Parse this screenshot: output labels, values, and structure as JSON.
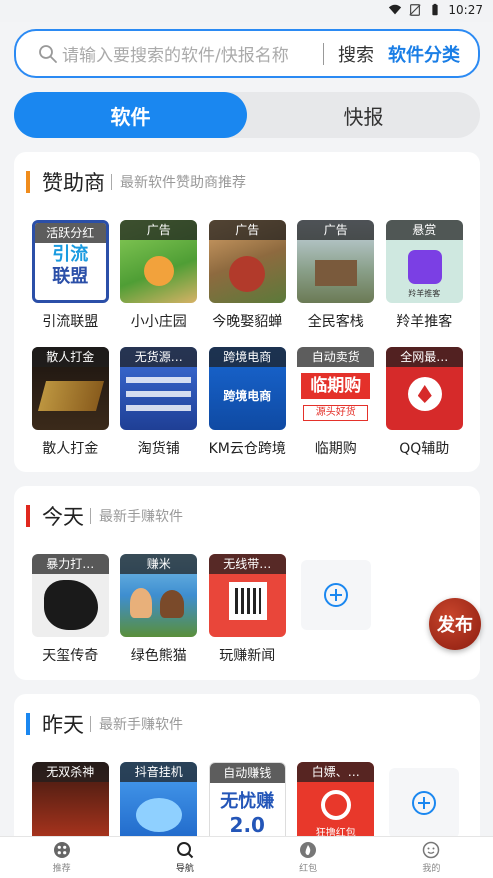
{
  "status": {
    "time": "10:27"
  },
  "search": {
    "placeholder": "请输入要搜索的软件/快报名称",
    "search_label": "搜索",
    "category_label": "软件分类"
  },
  "tabs": [
    {
      "label": "软件"
    },
    {
      "label": "快报"
    }
  ],
  "sponsors": {
    "title": "赞助商",
    "subtitle": "最新软件赞助商推荐",
    "items": [
      {
        "tag": "活跃分红",
        "name": "引流联盟"
      },
      {
        "tag": "广告",
        "name": "小小庄园"
      },
      {
        "tag": "广告",
        "name": "今晚娶貂蝉"
      },
      {
        "tag": "广告",
        "name": "全民客栈"
      },
      {
        "tag": "悬赏",
        "name": "羚羊推客"
      },
      {
        "tag": "散人打金",
        "name": "散人打金"
      },
      {
        "tag": "无货源…",
        "name": "淘货铺"
      },
      {
        "tag": "跨境电商",
        "name": "KM云仓跨境"
      },
      {
        "tag": "自动卖货",
        "name": "临期购"
      },
      {
        "tag": "全网最…",
        "name": "QQ辅助"
      }
    ]
  },
  "today": {
    "title": "今天",
    "subtitle": "最新手赚软件",
    "items": [
      {
        "tag": "暴力打…",
        "name": "天玺传奇"
      },
      {
        "tag": "赚米",
        "name": "绿色熊猫"
      },
      {
        "tag": "无线带…",
        "name": "玩赚新闻"
      }
    ]
  },
  "yesterday": {
    "title": "昨天",
    "subtitle": "最新手赚软件",
    "items": [
      {
        "tag": "无双杀神",
        "name": ""
      },
      {
        "tag": "抖音挂机",
        "name": ""
      },
      {
        "tag": "自动赚钱",
        "name": ""
      },
      {
        "tag": "白嫖、…",
        "name": ""
      }
    ]
  },
  "fab": {
    "label": "发布"
  },
  "nav": [
    {
      "label": "推荐"
    },
    {
      "label": "导航"
    },
    {
      "label": "红包"
    },
    {
      "label": "我的"
    }
  ],
  "thumb_texts": {
    "yinliu": [
      "引流",
      "联盟"
    ],
    "linqi": [
      "临期购",
      "源头好货"
    ],
    "wuyou": [
      "无忧赚",
      "2.0"
    ],
    "kuajing": "跨境电商",
    "kuang": "狂撸红包",
    "lingyang": "羚羊推客"
  },
  "colors": {
    "accent": "#1a87f0",
    "orange_bar": "#f08c1c",
    "red_bar": "#e0281e",
    "blue_bar": "#1a87f0"
  }
}
